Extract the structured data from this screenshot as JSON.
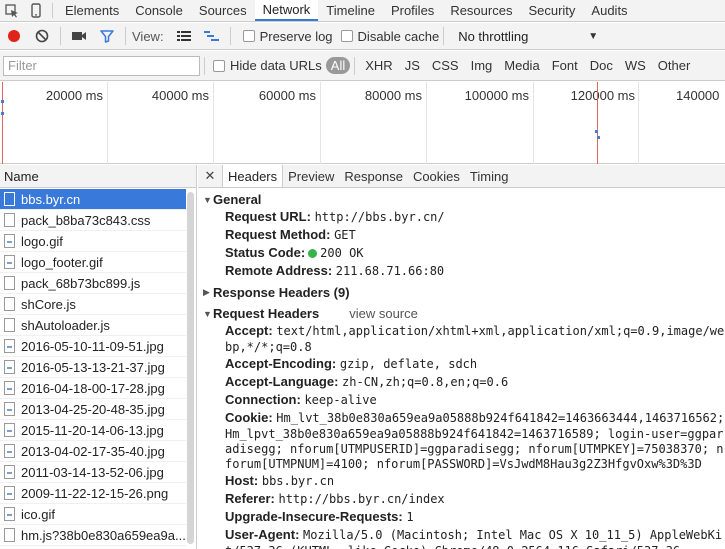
{
  "tabs": [
    "Elements",
    "Console",
    "Sources",
    "Network",
    "Timeline",
    "Profiles",
    "Resources",
    "Security",
    "Audits"
  ],
  "active_tab": "Network",
  "toolbar": {
    "view_label": "View:",
    "preserve_log": "Preserve log",
    "disable_cache": "Disable cache",
    "throttling": "No throttling"
  },
  "filter": {
    "placeholder": "Filter",
    "hide_data_urls": "Hide data URLs",
    "types": [
      "All",
      "XHR",
      "JS",
      "CSS",
      "Img",
      "Media",
      "Font",
      "Doc",
      "WS",
      "Other"
    ]
  },
  "overview": {
    "ticks": [
      "20000 ms",
      "40000 ms",
      "60000 ms",
      "80000 ms",
      "100000 ms",
      "120000 ms",
      "140000"
    ]
  },
  "list": {
    "header": "Name",
    "files": [
      {
        "name": "bbs.byr.cn",
        "type": "doc"
      },
      {
        "name": "pack_b8ba73c843.css",
        "type": "doc"
      },
      {
        "name": "logo.gif",
        "type": "img"
      },
      {
        "name": "logo_footer.gif",
        "type": "img"
      },
      {
        "name": "pack_68b73bc899.js",
        "type": "doc"
      },
      {
        "name": "shCore.js",
        "type": "doc"
      },
      {
        "name": "shAutoloader.js",
        "type": "doc"
      },
      {
        "name": "2016-05-10-11-09-51.jpg",
        "type": "img"
      },
      {
        "name": "2016-05-13-13-21-37.jpg",
        "type": "img"
      },
      {
        "name": "2016-04-18-00-17-28.jpg",
        "type": "img"
      },
      {
        "name": "2013-04-25-20-48-35.jpg",
        "type": "img"
      },
      {
        "name": "2015-11-20-14-06-13.jpg",
        "type": "img"
      },
      {
        "name": "2013-04-02-17-35-40.jpg",
        "type": "img"
      },
      {
        "name": "2011-03-14-13-52-06.jpg",
        "type": "img"
      },
      {
        "name": "2009-11-22-12-15-26.png",
        "type": "img"
      },
      {
        "name": "ico.gif",
        "type": "img"
      },
      {
        "name": "hm.js?38b0e830a659ea9a...",
        "type": "doc"
      }
    ]
  },
  "detail_tabs": [
    "Headers",
    "Preview",
    "Response",
    "Cookies",
    "Timing"
  ],
  "general": {
    "title": "General",
    "rows": [
      {
        "k": "Request URL:",
        "v": "http://bbs.byr.cn/"
      },
      {
        "k": "Request Method:",
        "v": "GET"
      },
      {
        "k": "Status Code:",
        "v": "200 OK"
      },
      {
        "k": "Remote Address:",
        "v": "211.68.71.66:80"
      }
    ]
  },
  "response_headers": {
    "title": "Response Headers (9)"
  },
  "request_headers": {
    "title": "Request Headers",
    "view_source": "view source",
    "rows": [
      {
        "k": "Accept:",
        "v": "text/html,application/xhtml+xml,application/xml;q=0.9,image/we",
        "cont": [
          "bp,*/*;q=0.8"
        ]
      },
      {
        "k": "Accept-Encoding:",
        "v": "gzip, deflate, sdch",
        "cont": []
      },
      {
        "k": "Accept-Language:",
        "v": "zh-CN,zh;q=0.8,en;q=0.6",
        "cont": []
      },
      {
        "k": "Connection:",
        "v": "keep-alive",
        "cont": []
      },
      {
        "k": "Cookie:",
        "v": "Hm_lvt_38b0e830a659ea9a05888b924f641842=1463663444,1463716562;",
        "cont": [
          "Hm_lpvt_38b0e830a659ea9a05888b924f641842=1463716589; login-user=ggpar",
          "adisegg; nforum[UTMPUSERID]=ggparadisegg; nforum[UTMPKEY]=75038370; n",
          "forum[UTMPNUM]=4100; nforum[PASSWORD]=VsJwdM8Hau3g2Z3HfgvOxw%3D%3D"
        ]
      },
      {
        "k": "Host:",
        "v": "bbs.byr.cn",
        "cont": []
      },
      {
        "k": "Referer:",
        "v": "http://bbs.byr.cn/index",
        "cont": []
      },
      {
        "k": "Upgrade-Insecure-Requests:",
        "v": "1",
        "cont": []
      },
      {
        "k": "User-Agent:",
        "v": "Mozilla/5.0 (Macintosh; Intel Mac OS X 10_11_5) AppleWebKi",
        "cont": [
          "t/537.36 (KHTML, like Gecko) Chrome/48.0.2564.116 Safari/537.36"
        ]
      }
    ]
  },
  "colors": {
    "accent": "#3879d9",
    "record": "#e2231a",
    "status_ok": "#37b24d"
  }
}
